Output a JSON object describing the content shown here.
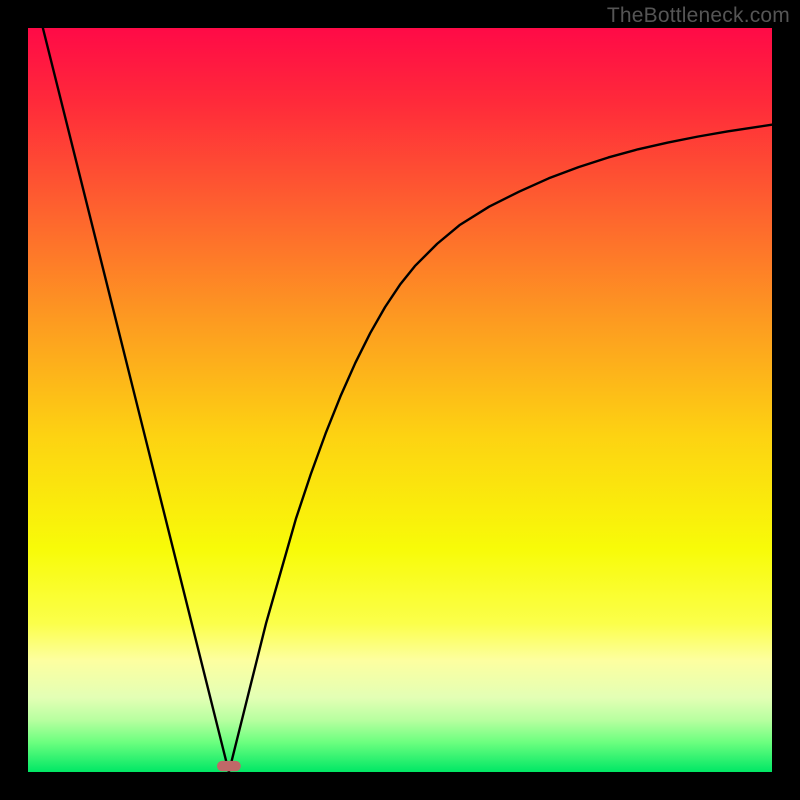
{
  "watermark": "TheBottleneck.com",
  "chart_data": {
    "type": "line",
    "title": "",
    "xlabel": "",
    "ylabel": "",
    "xlim": [
      0,
      100
    ],
    "ylim": [
      0,
      100
    ],
    "grid": false,
    "legend": false,
    "gradient_stops": [
      {
        "pos": 0.0,
        "color": "#ff0a47"
      },
      {
        "pos": 0.1,
        "color": "#ff2a3a"
      },
      {
        "pos": 0.25,
        "color": "#fe642e"
      },
      {
        "pos": 0.4,
        "color": "#fd9d20"
      },
      {
        "pos": 0.55,
        "color": "#fdd312"
      },
      {
        "pos": 0.7,
        "color": "#f8fb08"
      },
      {
        "pos": 0.8,
        "color": "#fbff4a"
      },
      {
        "pos": 0.85,
        "color": "#fdffa0"
      },
      {
        "pos": 0.9,
        "color": "#e3ffb5"
      },
      {
        "pos": 0.93,
        "color": "#b8ffa0"
      },
      {
        "pos": 0.96,
        "color": "#6cff7f"
      },
      {
        "pos": 1.0,
        "color": "#00e765"
      }
    ],
    "minimum_x": 27.0,
    "marker": {
      "x": 27.0,
      "y": 0.8,
      "w": 3.2,
      "h": 1.4,
      "color": "#c06868"
    },
    "series": [
      {
        "name": "curve",
        "color": "#000000",
        "x": [
          2,
          4,
          6,
          8,
          10,
          12,
          14,
          16,
          18,
          20,
          22,
          24,
          25,
          26,
          27,
          28,
          29,
          30,
          32,
          34,
          36,
          38,
          40,
          42,
          44,
          46,
          48,
          50,
          52,
          55,
          58,
          62,
          66,
          70,
          74,
          78,
          82,
          86,
          90,
          94,
          98,
          100
        ],
        "y": [
          100,
          92,
          84,
          76,
          68,
          60,
          52,
          44,
          36,
          28,
          20,
          12,
          8,
          4,
          0,
          4,
          8,
          12,
          20,
          27,
          34,
          40,
          45.5,
          50.5,
          55,
          59,
          62.5,
          65.5,
          68,
          71,
          73.5,
          76,
          78,
          79.8,
          81.3,
          82.6,
          83.7,
          84.6,
          85.4,
          86.1,
          86.7,
          87.0
        ]
      }
    ]
  }
}
